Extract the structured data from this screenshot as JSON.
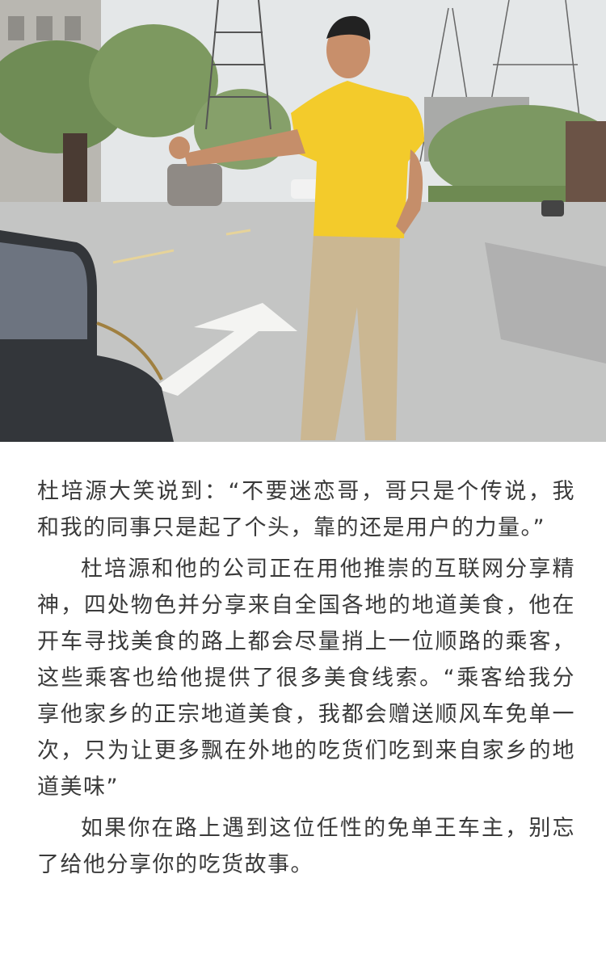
{
  "photo": {
    "alt_subject": "man-hitchhiking-on-road"
  },
  "article": {
    "paragraphs": [
      "杜培源大笑说到：“不要迷恋哥，哥只是个传说，我和我的同事只是起了个头，靠的还是用户的力量。”",
      "杜培源和他的公司正在用他推崇的互联网分享精神，四处物色并分享来自全国各地的地道美食，他在开车寻找美食的路上都会尽量捎上一位顺路的乘客，这些乘客也给他提供了很多美食线索。“乘客给我分享他家乡的正宗地道美食，我都会赠送顺风车免单一次，只为让更多飘在外地的吃货们吃到来自家乡的地道美味”",
      "如果你在路上遇到这位任性的免单王车主，别忘了给他分享你的吃货故事。"
    ]
  },
  "colors": {
    "text": "#3a3a3a",
    "shirt": "#f4cc2a",
    "pants": "#cdb894",
    "road": "#c6c7c6"
  }
}
